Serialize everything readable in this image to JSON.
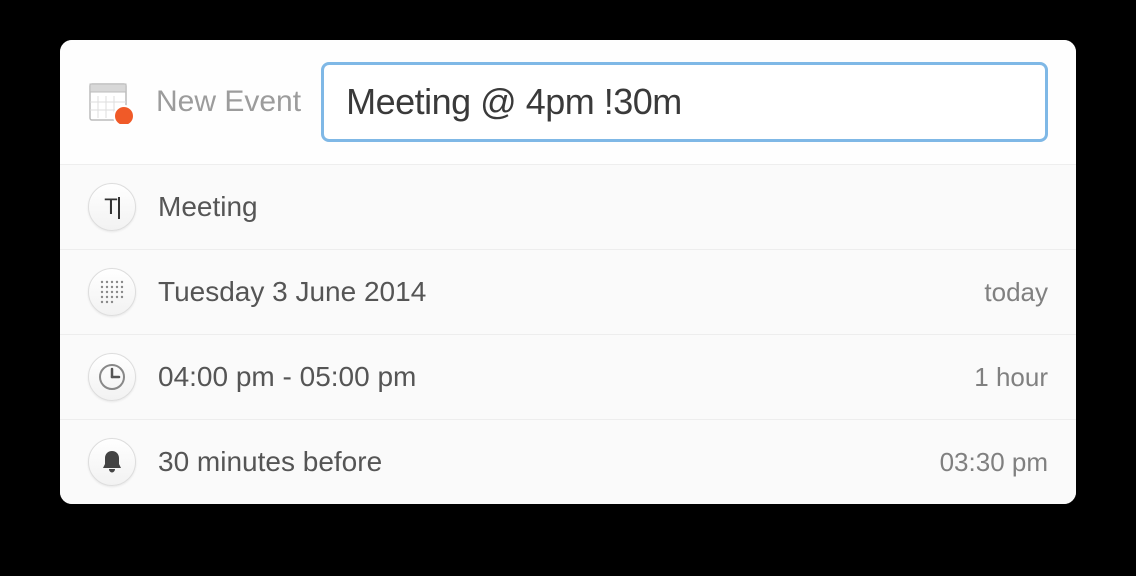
{
  "header": {
    "label": "New Event",
    "input_value": "Meeting @ 4pm !30m"
  },
  "details": {
    "title": {
      "value": "Meeting"
    },
    "date": {
      "value": "Tuesday 3 June 2014",
      "relative": "today"
    },
    "time": {
      "value": "04:00 pm - 05:00 pm",
      "duration": "1 hour"
    },
    "reminder": {
      "value": "30 minutes before",
      "time": "03:30 pm"
    }
  },
  "colors": {
    "accent": "#f05a28",
    "input_border": "#7fb8e6"
  }
}
